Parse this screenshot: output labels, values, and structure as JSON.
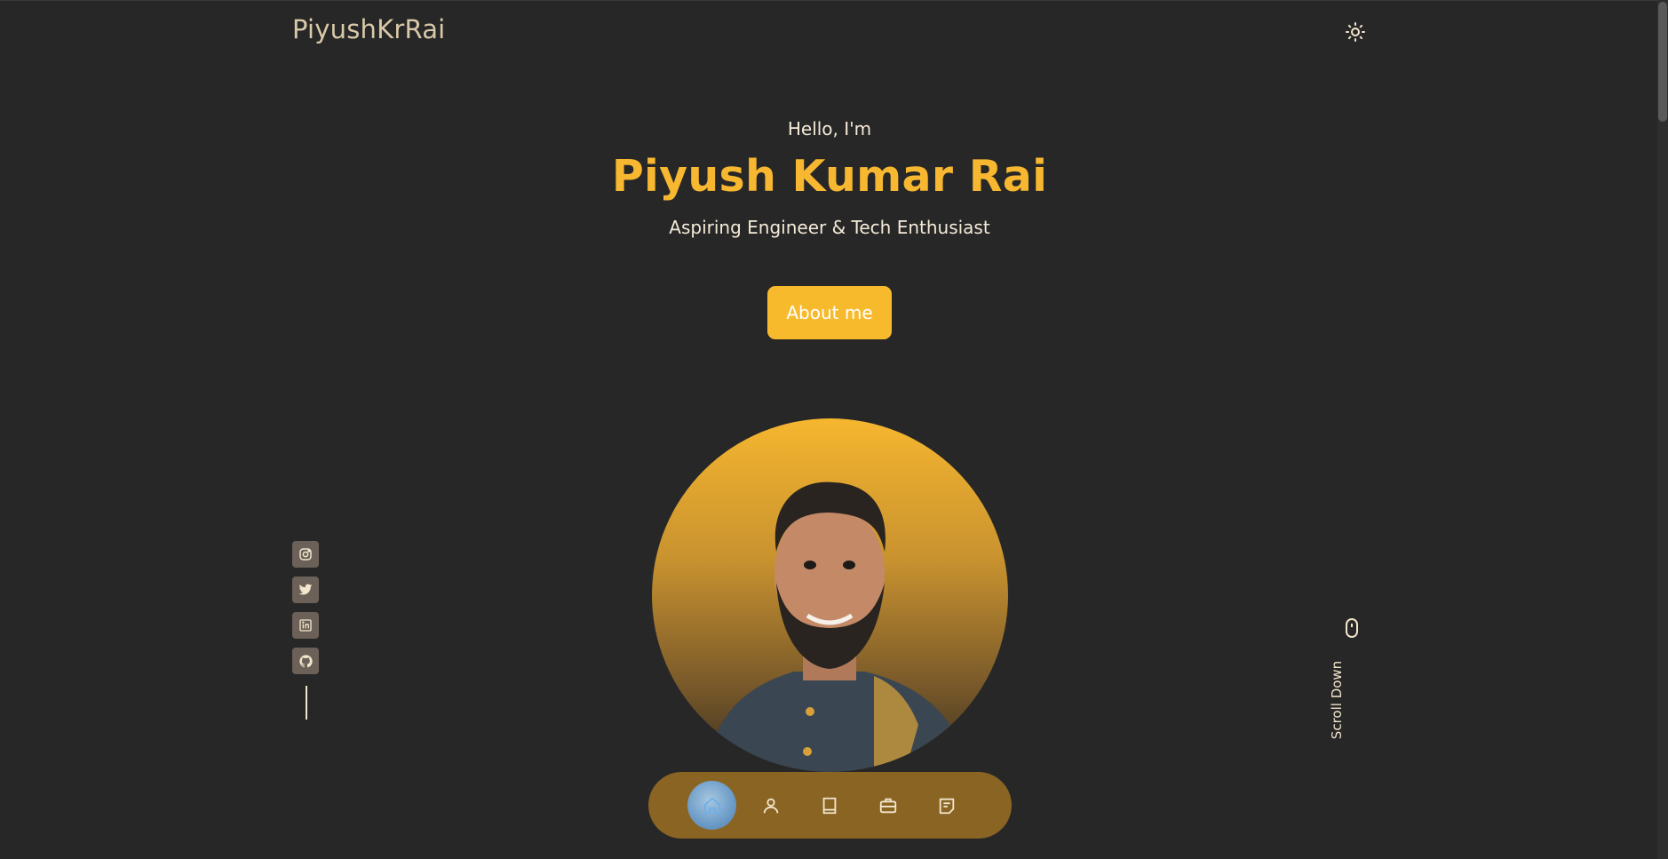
{
  "header": {
    "logo": "PiyushKrRai",
    "theme_toggle_icon": "sun-icon"
  },
  "hero": {
    "greeting": "Hello, I'm",
    "name": "Piyush Kumar Rai",
    "subtitle": "Aspiring Engineer & Tech Enthusiast",
    "cta_label": "About me"
  },
  "socials": [
    {
      "icon": "instagram-icon"
    },
    {
      "icon": "twitter-icon"
    },
    {
      "icon": "linkedin-icon"
    },
    {
      "icon": "github-icon"
    }
  ],
  "scroll": {
    "label": "Scroll Down",
    "icon": "mouse-icon"
  },
  "nav": {
    "items": [
      {
        "icon": "home-icon",
        "active": true
      },
      {
        "icon": "user-icon",
        "active": false
      },
      {
        "icon": "book-icon",
        "active": false
      },
      {
        "icon": "briefcase-icon",
        "active": false
      },
      {
        "icon": "message-icon",
        "active": false
      }
    ]
  },
  "colors": {
    "background": "#272727",
    "accent": "#f7b731",
    "text": "#f4ead8",
    "nav_bg": "#8a6423"
  }
}
